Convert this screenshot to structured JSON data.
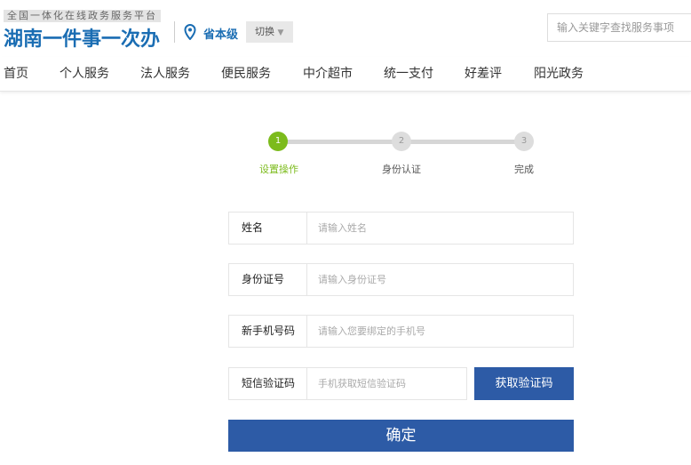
{
  "header": {
    "subtitle": "全国一体化在线政务服务平台",
    "logo": "湖南一件事一次办",
    "level": "省本级",
    "switch": "切换",
    "search_placeholder": "输入关键字查找服务事项"
  },
  "nav": [
    "首页",
    "个人服务",
    "法人服务",
    "便民服务",
    "中介超市",
    "统一支付",
    "好差评",
    "阳光政务"
  ],
  "steps": [
    {
      "num": "1",
      "label": "设置操作"
    },
    {
      "num": "2",
      "label": "身份认证"
    },
    {
      "num": "3",
      "label": "完成"
    }
  ],
  "form": {
    "name_label": "姓名",
    "name_ph": "请输入姓名",
    "id_label": "身份证号",
    "id_ph": "请输入身份证号",
    "phone_label": "新手机号码",
    "phone_ph": "请输入您要绑定的手机号",
    "code_label": "短信验证码",
    "code_ph": "手机获取短信验证码",
    "get_code": "获取验证码",
    "submit": "确定"
  },
  "colors": {
    "active": "#7cbb1c",
    "primary": "#2d5ba6"
  }
}
